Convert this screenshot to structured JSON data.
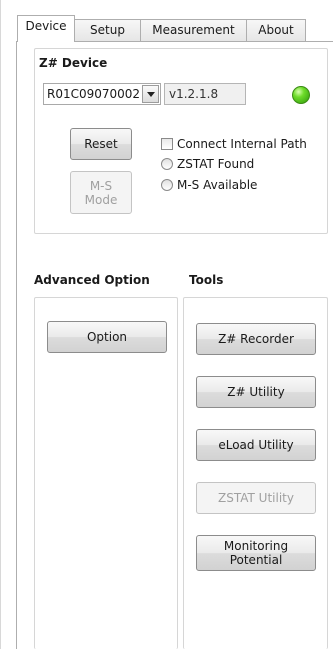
{
  "tabs": [
    {
      "label": "Device",
      "active": true
    },
    {
      "label": "Setup",
      "active": false
    },
    {
      "label": "Measurement",
      "active": false
    },
    {
      "label": "About",
      "active": false
    }
  ],
  "device_group": {
    "title": "Z# Device",
    "device_select_value": "R01C09070002",
    "version": "v1.2.1.8",
    "status_led_color": "#3ec21a",
    "reset_label": "Reset",
    "ms_mode_label": "M-S\nMode",
    "connect_internal_path_label": "Connect Internal Path",
    "zstat_found_label": "ZSTAT Found",
    "ms_available_label": "M-S Available"
  },
  "advanced_group": {
    "title": "Advanced Option",
    "option_label": "Option"
  },
  "tools_group": {
    "title": "Tools",
    "zrecorder_label": "Z# Recorder",
    "zutility_label": "Z# Utility",
    "eload_label": "eLoad Utility",
    "zstat_utility_label": "ZSTAT Utility",
    "monitoring_label": "Monitoring\nPotential"
  }
}
